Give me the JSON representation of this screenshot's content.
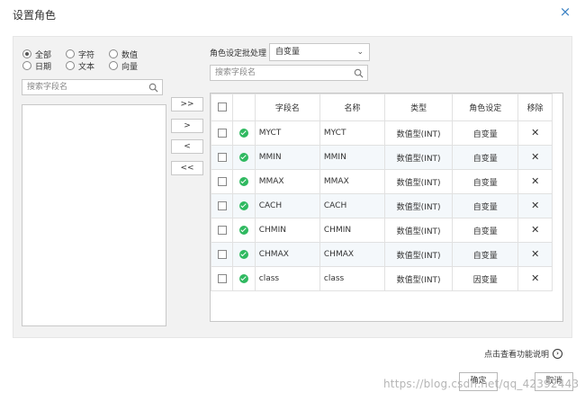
{
  "dialog": {
    "title": "设置角色",
    "close_icon": "×"
  },
  "filter": {
    "options": [
      {
        "label": "全部",
        "selected": true
      },
      {
        "label": "字符",
        "selected": false
      },
      {
        "label": "数值",
        "selected": false
      },
      {
        "label": "日期",
        "selected": false
      },
      {
        "label": "文本",
        "selected": false
      },
      {
        "label": "向量",
        "selected": false
      }
    ]
  },
  "left_search": {
    "placeholder": "搜索字段名"
  },
  "move_buttons": {
    "move_all_right": ">>",
    "move_right": ">",
    "move_left": "<",
    "move_all_left": "<<"
  },
  "batch": {
    "label": "角色设定批处理",
    "selected": "自变量",
    "chevron": "⌄"
  },
  "right_search": {
    "placeholder": "搜索字段名"
  },
  "table": {
    "headers": [
      "",
      "",
      "字段名",
      "名称",
      "类型",
      "角色设定",
      "移除"
    ],
    "rows": [
      {
        "field": "MYCT",
        "name": "MYCT",
        "type": "数值型(INT)",
        "role": "自变量",
        "remove": "✕"
      },
      {
        "field": "MMIN",
        "name": "MMIN",
        "type": "数值型(INT)",
        "role": "自变量",
        "remove": "✕"
      },
      {
        "field": "MMAX",
        "name": "MMAX",
        "type": "数值型(INT)",
        "role": "自变量",
        "remove": "✕"
      },
      {
        "field": "CACH",
        "name": "CACH",
        "type": "数值型(INT)",
        "role": "自变量",
        "remove": "✕"
      },
      {
        "field": "CHMIN",
        "name": "CHMIN",
        "type": "数值型(INT)",
        "role": "自变量",
        "remove": "✕"
      },
      {
        "field": "CHMAX",
        "name": "CHMAX",
        "type": "数值型(INT)",
        "role": "自变量",
        "remove": "✕"
      },
      {
        "field": "class",
        "name": "class",
        "type": "数值型(INT)",
        "role": "因变量",
        "remove": "✕"
      }
    ]
  },
  "help": {
    "label": "点击查看功能说明",
    "icon": "›"
  },
  "footer": {
    "ok_label": "确定",
    "cancel_label": "取消"
  },
  "watermark": "https://blog.csdn.net/qq_42392443"
}
